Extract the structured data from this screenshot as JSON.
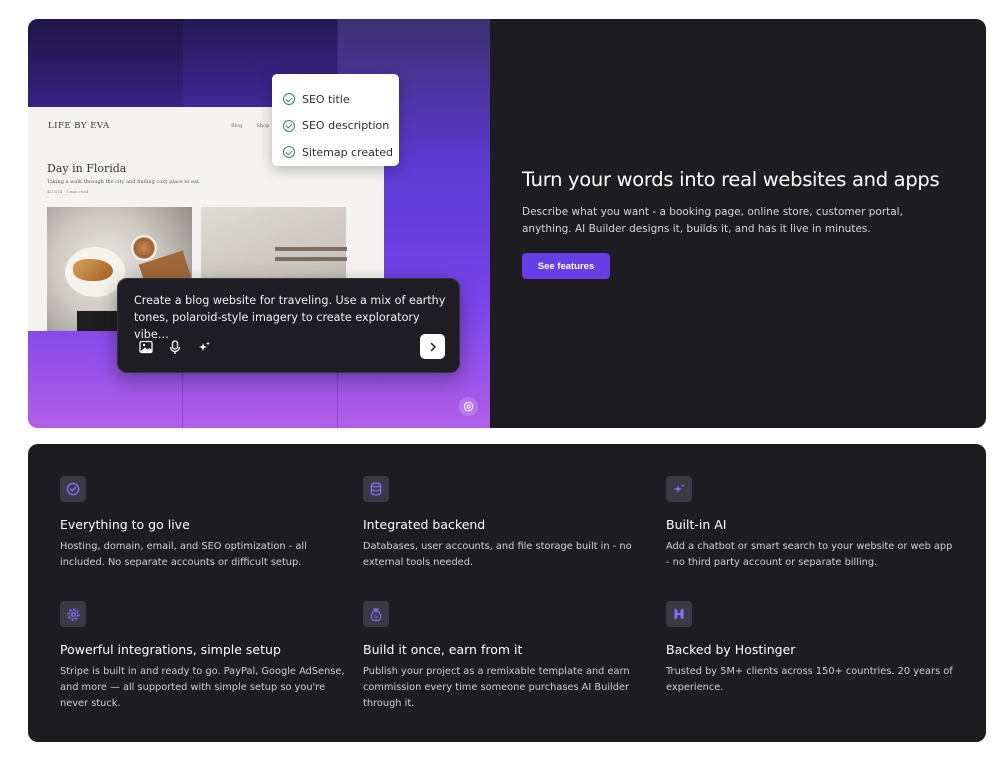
{
  "colors": {
    "accent": "#673de6",
    "panel_bg": "#1d1d21",
    "icon_bg": "#3a3a44",
    "icon_tint": "#8c6cff",
    "check_green": "#2f8a6b"
  },
  "blog_preview": {
    "brand": "LIFE BY EVA",
    "nav": [
      "Blog",
      "Shop"
    ],
    "title": "Day in Florida",
    "subtitle": "Taking a walk through the city and finding cozy place to eat.",
    "meta": "4/20/24 · 5 min read"
  },
  "seo_checklist": {
    "items": [
      {
        "label": "SEO title",
        "icon": "check-circle-icon"
      },
      {
        "label": "SEO description",
        "icon": "check-circle-icon"
      },
      {
        "label": "Sitemap created",
        "icon": "check-circle-icon"
      }
    ]
  },
  "prompt": {
    "text": "Create a blog website for traveling. Use a mix of earthy tones, polaroid-style imagery to create exploratory vibe…",
    "icons": [
      "image-icon",
      "microphone-icon",
      "sparkles-icon"
    ],
    "send_icon": "chevron-right-icon"
  },
  "hero": {
    "title": "Turn your words into real websites and apps",
    "description": "Describe what you want - a booking page, online store, customer portal, anything. AI Builder designs it, builds it, and has it live in minutes.",
    "cta_label": "See features"
  },
  "features": [
    {
      "title": "Everything to go live",
      "description": "Hosting, domain, email, and SEO optimization - all included. No separate accounts or difficult setup.",
      "icon": "check-circle-icon"
    },
    {
      "title": "Integrated backend",
      "description": "Databases, user accounts, and file storage built in - no external tools needed.",
      "icon": "database-icon"
    },
    {
      "title": "Built-in AI",
      "description": "Add a chatbot or smart search to your website or web app - no third party account or separate billing.",
      "icon": "sparkles-icon"
    },
    {
      "title": "Powerful integrations, simple setup",
      "description": "Stripe is built in and ready to go. PayPal, Google AdSense, and more — all supported with simple setup so you're never stuck.",
      "icon": "gear-icon"
    },
    {
      "title": "Build it once, earn from it",
      "description": "Publish your project as a remixable template and earn commission every time someone purchases AI Builder through it.",
      "icon": "money-bag-icon"
    },
    {
      "title": "Backed by Hostinger",
      "description": "Trusted by 5M+ clients across 150+ countries. 20 years of experience.",
      "icon": "hostinger-logo-icon"
    }
  ]
}
